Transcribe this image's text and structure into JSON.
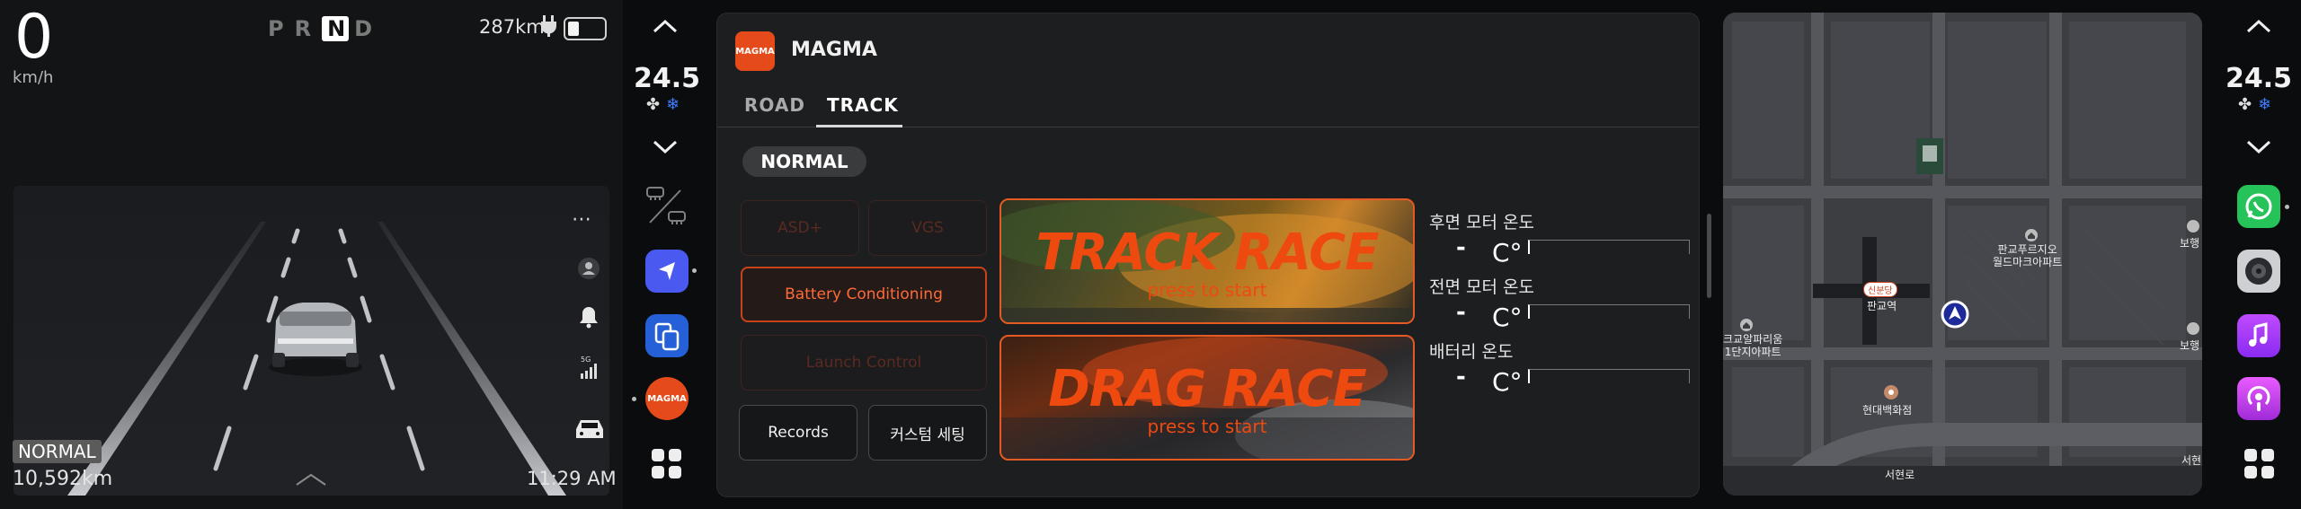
{
  "cluster": {
    "speed": "0",
    "speed_unit": "km/h",
    "gear": {
      "p": "P",
      "r": "R",
      "n": "N",
      "d": "D"
    },
    "range": "287km",
    "drive_mode": "NORMAL",
    "odometer": "10,592km",
    "time": "11:29 AM",
    "more_icon": "more-dots-icon",
    "signal_label": "5G"
  },
  "dock": {
    "temperature": "24.5",
    "icons": [
      "chevron-up-icon",
      "chevron-down-icon",
      "defrost-icon",
      "navigation-icon",
      "phone-projection-icon",
      "magma-app-icon",
      "app-grid-icon"
    ],
    "magma_label": "MAGMA"
  },
  "app": {
    "title": "MAGMA",
    "logo_text": "MAGMA",
    "tabs": [
      {
        "label": "ROAD"
      },
      {
        "label": "TRACK"
      }
    ],
    "active_tab": "TRACK",
    "mode": "NORMAL",
    "buttons": {
      "asd": "ASD+",
      "vgs": "VGS",
      "battery_conditioning": "Battery Conditioning",
      "launch_control": "Launch Control",
      "records": "Records",
      "custom_setting": "커스텀 세팅"
    },
    "track_race": {
      "title": "TRACK RACE",
      "sub": "press to start"
    },
    "drag_race": {
      "title": "DRAG RACE",
      "sub": "press to start"
    },
    "temps": [
      {
        "label": "후면 모터 온도",
        "value": "-",
        "unit": "C°"
      },
      {
        "label": "전면 모터 온도",
        "value": "-",
        "unit": "C°"
      },
      {
        "label": "배터리 온도",
        "value": "-",
        "unit": "C°"
      }
    ]
  },
  "map": {
    "labels": {
      "sinbundang": "신분당",
      "pangyo_station": "판교역",
      "pangyo_square": "판교푸르지오\n월드마크아파트",
      "hyundai": "현대백화점",
      "apartment_left": "크교알파리움\n1단지아파트",
      "road": "서현로",
      "right1": "보행",
      "right2": "보행",
      "right3": "서현"
    }
  },
  "right_dock": {
    "temperature": "24.5",
    "icons": [
      "chevron-up-icon",
      "chevron-down-icon",
      "whatsapp-icon",
      "camera-icon",
      "music-icon",
      "podcast-icon",
      "app-grid-icon"
    ]
  },
  "colors": {
    "accent": "#e54b1a",
    "background": "#0b0c0e",
    "panel": "#1d1e20"
  }
}
